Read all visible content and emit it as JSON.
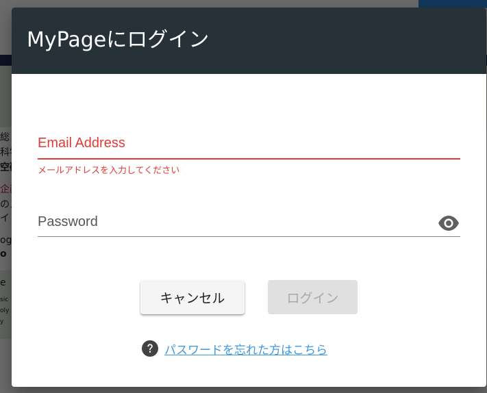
{
  "dialog": {
    "title": "MyPageにログイン",
    "email": {
      "label": "Email Address",
      "value": "",
      "error": "メールアドレスを入力してください"
    },
    "password": {
      "label": "Password",
      "value": "",
      "toggle_icon": "eye-icon"
    },
    "buttons": {
      "cancel_label": "キャンセル",
      "login_label": "ログイン"
    },
    "forgot": {
      "icon": "help-circle-icon",
      "link_text": "パスワードを忘れた方はこちら"
    }
  },
  "background_page": {
    "fragments": [
      "総",
      "科学",
      "空研",
      "企画",
      "のス",
      "イ",
      "og",
      "o",
      "e",
      "sic",
      "oly",
      "y"
    ]
  },
  "colors": {
    "header_bg": "#263238",
    "error_red": "#e53935",
    "link_blue": "#3d99e0",
    "disabled_button_bg": "#e0e0e0",
    "disabled_button_text": "#a8a8a8"
  }
}
